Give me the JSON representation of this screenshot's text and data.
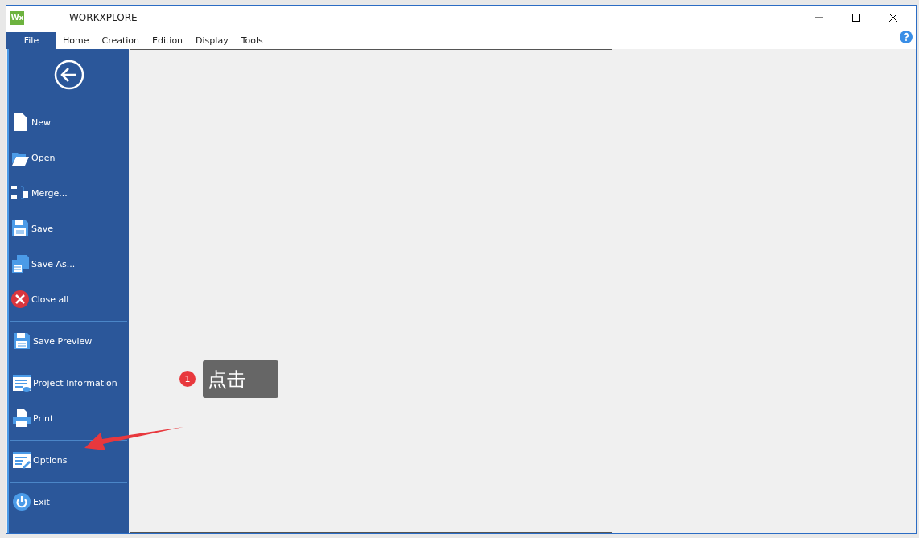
{
  "window": {
    "title": "WORKXPLORE",
    "logo": "Wx"
  },
  "tabs": [
    {
      "label": "File",
      "selected": true
    },
    {
      "label": "Home",
      "selected": false
    },
    {
      "label": "Creation",
      "selected": false
    },
    {
      "label": "Edition",
      "selected": false
    },
    {
      "label": "Display",
      "selected": false
    },
    {
      "label": "Tools",
      "selected": false
    }
  ],
  "sidebar": {
    "groups": [
      [
        {
          "label": "New",
          "kind": "new"
        },
        {
          "label": "Open",
          "kind": "open"
        },
        {
          "label": "Merge...",
          "kind": "merge"
        },
        {
          "label": "Save",
          "kind": "save"
        },
        {
          "label": "Save As...",
          "kind": "saveas"
        },
        {
          "label": "Close all",
          "kind": "close"
        }
      ],
      [
        {
          "label": "Save Preview",
          "kind": "save"
        }
      ],
      [
        {
          "label": "Project Information",
          "kind": "info"
        },
        {
          "label": "Print",
          "kind": "print"
        }
      ],
      [
        {
          "label": "Options",
          "kind": "options"
        }
      ],
      [
        {
          "label": "Exit",
          "kind": "exit"
        }
      ]
    ]
  },
  "callout": {
    "number": "1",
    "text": "点击"
  }
}
